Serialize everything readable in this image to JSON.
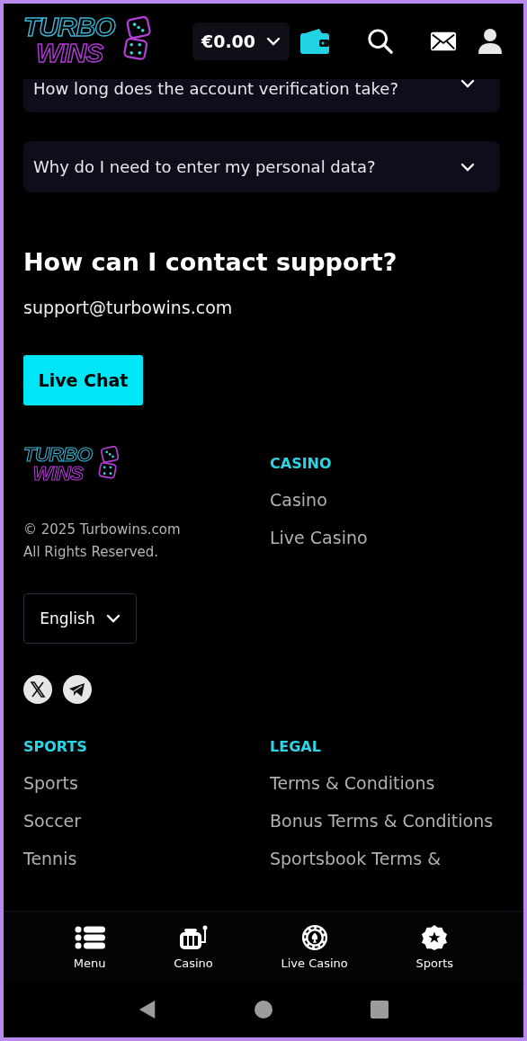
{
  "header": {
    "logo": {
      "line1": "TURBO",
      "line2": "WINS"
    },
    "balance": "€0.00"
  },
  "faq": [
    {
      "question": "How long does the account verification take?",
      "expanded": false
    },
    {
      "question": "Why do I need to enter my personal data?",
      "expanded": false
    }
  ],
  "contact": {
    "heading": "How can I contact support?",
    "email": "support@turbowins.com",
    "button": "Live Chat"
  },
  "footer": {
    "logo": {
      "line1": "TURBO",
      "line2": "WINS"
    },
    "copyright": [
      "© 2025 Turbowins.com",
      "All Rights Reserved."
    ],
    "language": "English",
    "socials": [
      {
        "kind": "x"
      },
      {
        "kind": "telegram"
      }
    ],
    "casino": {
      "title": "CASINO",
      "links": [
        "Casino",
        "Live Casino"
      ]
    },
    "sports": {
      "title": "SPORTS",
      "links": [
        "Sports",
        "Soccer",
        "Tennis"
      ]
    },
    "legal": {
      "title": "LEGAL",
      "links": [
        "Terms & Conditions",
        "Bonus Terms & Conditions",
        "Sportsbook Terms &"
      ]
    }
  },
  "bottom_nav": [
    {
      "label": "Menu",
      "kind": "menu"
    },
    {
      "label": "Casino",
      "kind": "slot"
    },
    {
      "label": "Live Casino",
      "kind": "chip"
    },
    {
      "label": "Sports",
      "kind": "sports"
    }
  ]
}
